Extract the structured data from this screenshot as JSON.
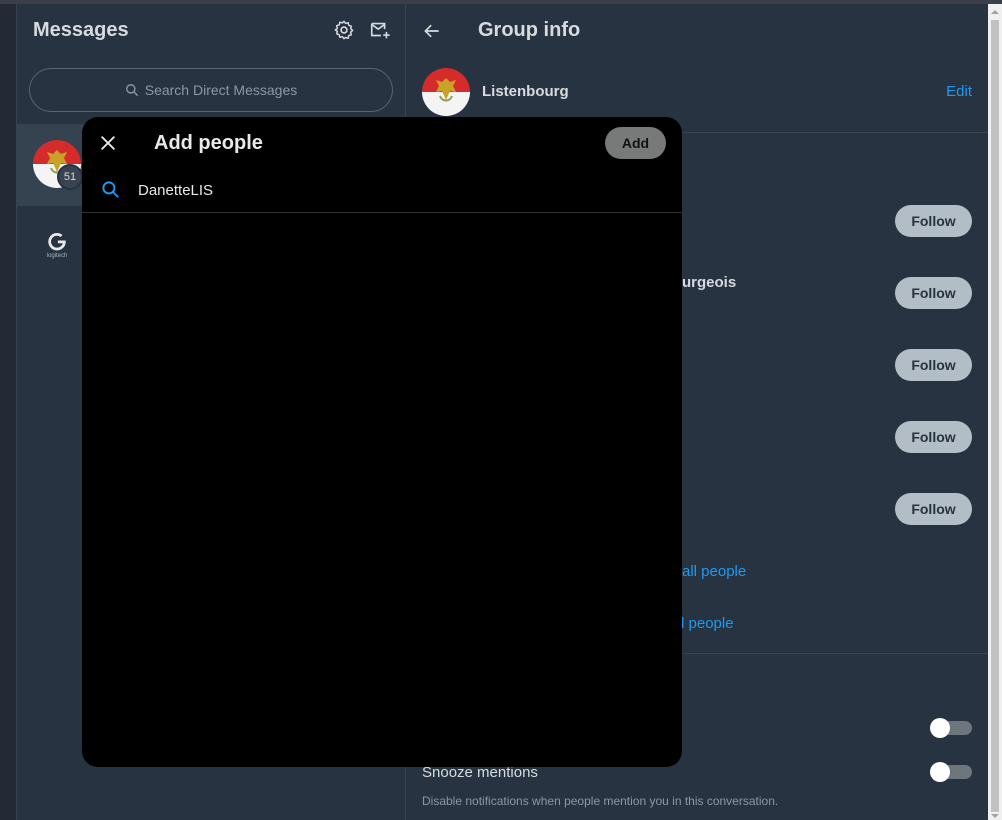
{
  "messages": {
    "title": "Messages",
    "search_placeholder": "Search Direct Messages",
    "conversations": [
      {
        "unread_count": "51"
      },
      {
        "logo_text": "logitech"
      }
    ]
  },
  "group_info": {
    "title": "Group info",
    "name": "Listenbourg",
    "edit_label": "Edit",
    "follow_label": "Follow",
    "partial_member_name": "urgeois",
    "show_all_label": "all people",
    "add_people_link": "d people",
    "snooze_label": "Snooze mentions",
    "snooze_description": "Disable notifications when people mention you in this conversation."
  },
  "modal": {
    "title": "Add people",
    "add_label": "Add",
    "search_value": "DanetteLIS"
  },
  "colors": {
    "accent": "#1d9bf0",
    "background": "#273340",
    "modal_background": "#000000"
  }
}
